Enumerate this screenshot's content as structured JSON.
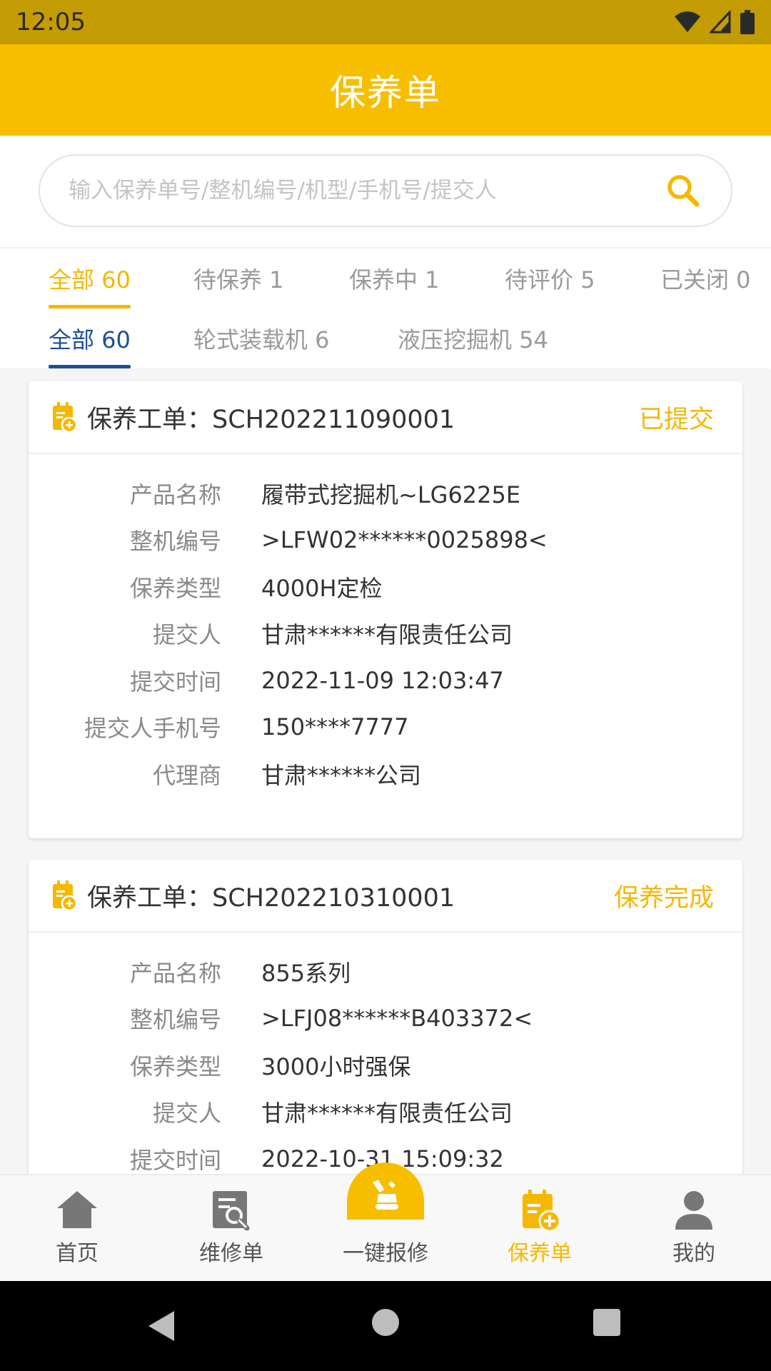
{
  "status_bar": {
    "time": "12:05"
  },
  "header": {
    "title": "保养单"
  },
  "search": {
    "placeholder": "输入保养单号/整机编号/机型/手机号/提交人",
    "value": ""
  },
  "status_tabs": [
    {
      "label": "全部 60",
      "active": true
    },
    {
      "label": "待保养 1",
      "active": false
    },
    {
      "label": "保养中 1",
      "active": false
    },
    {
      "label": "待评价 5",
      "active": false
    },
    {
      "label": "已关闭 0",
      "active": false
    }
  ],
  "type_tabs": [
    {
      "label": "全部 60",
      "active": true
    },
    {
      "label": "轮式装载机 6",
      "active": false
    },
    {
      "label": "液压挖掘机 54",
      "active": false
    }
  ],
  "orders": [
    {
      "title": "保养工单：SCH202211090001",
      "status": "已提交",
      "fields": [
        {
          "label": "产品名称",
          "value": "履带式挖掘机~LG6225E"
        },
        {
          "label": "整机编号",
          "value": ">LFW02******0025898<"
        },
        {
          "label": "保养类型",
          "value": "4000H定检"
        },
        {
          "label": "提交人",
          "value": "甘肃******有限责任公司"
        },
        {
          "label": "提交时间",
          "value": "2022-11-09 12:03:47"
        },
        {
          "label": "提交人手机号",
          "value": "150****7777"
        },
        {
          "label": "代理商",
          "value": "甘肃******公司"
        }
      ]
    },
    {
      "title": "保养工单：SCH202210310001",
      "status": "保养完成",
      "fields": [
        {
          "label": "产品名称",
          "value": "855系列"
        },
        {
          "label": "整机编号",
          "value": ">LFJ08******B403372<"
        },
        {
          "label": "保养类型",
          "value": "3000小时强保"
        },
        {
          "label": "提交人",
          "value": "甘肃******有限责任公司"
        },
        {
          "label": "提交时间",
          "value": "2022-10-31 15:09:32"
        }
      ]
    }
  ],
  "bottom_nav": [
    {
      "label": "首页",
      "icon": "home-icon",
      "active": false
    },
    {
      "label": "维修单",
      "icon": "repair-order-icon",
      "active": false
    },
    {
      "label": "一键报修",
      "icon": "excavator-repair-icon",
      "active": false
    },
    {
      "label": "保养单",
      "icon": "maintenance-order-icon",
      "active": true
    },
    {
      "label": "我的",
      "icon": "user-icon",
      "active": false
    }
  ],
  "colors": {
    "accent": "#f7be00",
    "status_bar": "#c39b03",
    "active_blue": "#1f4e9a",
    "label_gray": "#8a8a8a"
  }
}
